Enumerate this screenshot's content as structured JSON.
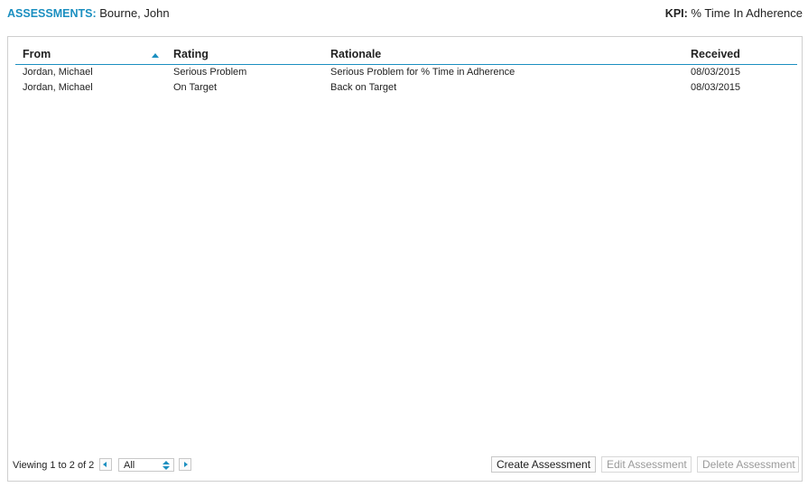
{
  "header": {
    "assessments_label": "ASSESSMENTS:",
    "employee_name": "Bourne, John",
    "kpi_label": "KPI:",
    "kpi_value": "% Time In Adherence"
  },
  "grid": {
    "columns": {
      "from": "From",
      "rating": "Rating",
      "rationale": "Rationale",
      "received": "Received"
    },
    "sort_icon": "sort-ascending-icon",
    "rows": [
      {
        "from": "Jordan, Michael",
        "rating": "Serious Problem",
        "rationale": "Serious Problem for % Time in Adherence",
        "received": "08/03/2015"
      },
      {
        "from": "Jordan, Michael",
        "rating": "On Target",
        "rationale": "Back on Target",
        "received": "08/03/2015"
      }
    ]
  },
  "footer": {
    "viewing_text": "Viewing 1 to 2 of 2",
    "page_size_value": "All",
    "prev_icon": "prev-page-icon",
    "next_icon": "next-page-icon",
    "create_label": "Create Assessment",
    "edit_label": "Edit Assessment",
    "delete_label": "Delete Assessment"
  },
  "colors": {
    "accent": "#1b8fc0",
    "border": "#cfcfcf",
    "disabled_text": "#9a9a9a"
  }
}
